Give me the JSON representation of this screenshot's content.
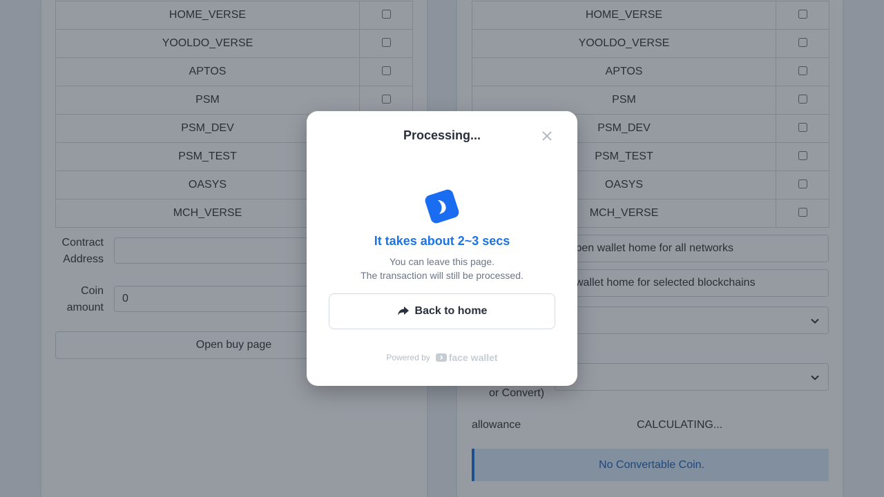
{
  "networks": [
    "HOME_VERSE",
    "YOOLDO_VERSE",
    "APTOS",
    "PSM",
    "PSM_DEV",
    "PSM_TEST",
    "OASYS",
    "MCH_VERSE"
  ],
  "left": {
    "contract_address_label_1": "Contract",
    "contract_address_label_2": "Address",
    "contract_address_value": "",
    "coin_amount_label_1": "Coin",
    "coin_amount_label_2": "amount",
    "coin_amount_value": "0",
    "open_buy_page_label": "Open buy page"
  },
  "right": {
    "open_wallet_all_label": "Open wallet home for all networks",
    "open_wallet_selected_label": "Open wallet home for selected blockchains",
    "convert_label_tail": "or Convert)",
    "allowance_label": "allowance",
    "allowance_value": "CALCULATING...",
    "no_convertable_label": "No Convertable Coin."
  },
  "modal": {
    "title": "Processing...",
    "headline": "It takes about 2~3 secs",
    "subtext_1": "You can leave this page.",
    "subtext_2": "The transaction will still be processed.",
    "back_button_label": "Back to home",
    "powered_by": "Powered by",
    "brand": "face wallet",
    "brand_color": "#1a73e8"
  }
}
